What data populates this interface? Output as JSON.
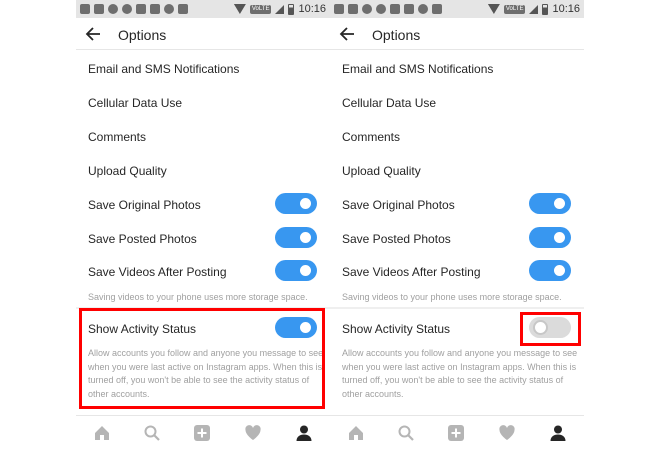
{
  "statusbar": {
    "network": "VoLTE",
    "time": "10:16"
  },
  "header": {
    "title": "Options"
  },
  "items": {
    "email_sms": "Email and SMS Notifications",
    "cellular": "Cellular Data Use",
    "comments": "Comments",
    "upload_quality": "Upload Quality",
    "save_original": "Save Original Photos",
    "save_posted": "Save Posted Photos",
    "save_videos": "Save Videos After Posting",
    "save_videos_note": "Saving videos to your phone uses more storage space.",
    "activity_status": "Show Activity Status",
    "activity_note": "Allow accounts you follow and anyone you message to see when you were last active on Instagram apps. When this is turned off, you won't be able to see the activity status of other accounts."
  },
  "toggle_states": {
    "left": {
      "save_original": true,
      "save_posted": true,
      "save_videos": true,
      "activity_status": true
    },
    "right": {
      "save_original": true,
      "save_posted": true,
      "save_videos": true,
      "activity_status": false
    }
  },
  "colors": {
    "toggle_on": "#3897f0",
    "toggle_off": "#dbdbdb",
    "highlight": "#ff0000"
  },
  "tabs": [
    "home-icon",
    "search-icon",
    "add-post-icon",
    "heart-icon",
    "profile-icon"
  ]
}
